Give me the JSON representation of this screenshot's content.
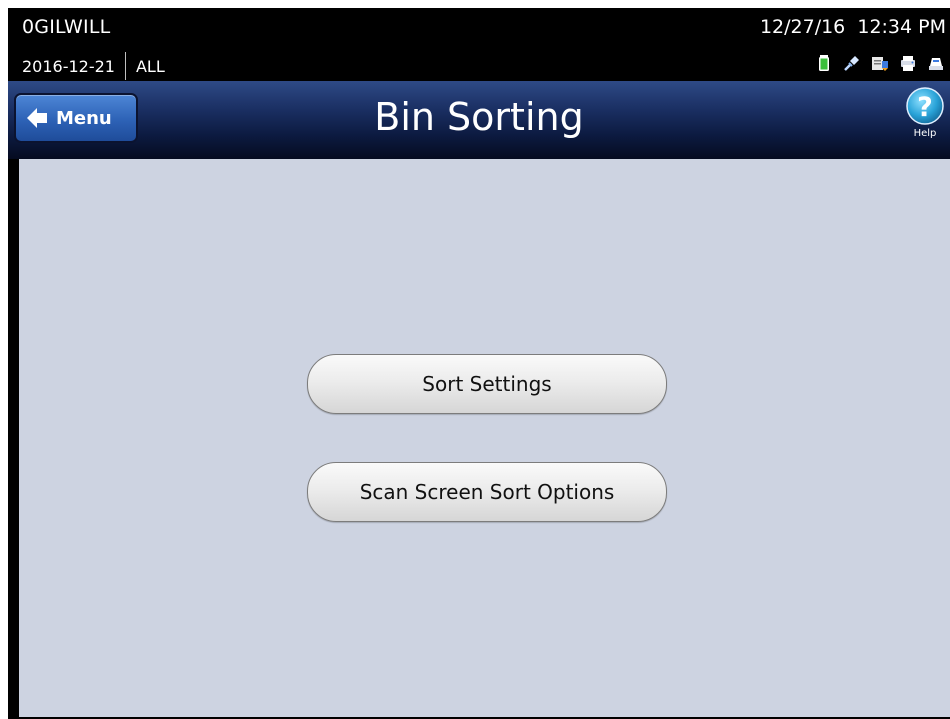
{
  "status_bar": {
    "user": "0GILWILL",
    "date": "2016-12-21",
    "filter": "ALL",
    "datetime": "12/27/16  12:34 PM",
    "icons": [
      "battery-icon",
      "connection-icon",
      "sync-icon",
      "printer-icon",
      "dock-icon"
    ]
  },
  "header": {
    "menu_label": "Menu",
    "title": "Bin Sorting",
    "help_label": "Help"
  },
  "main": {
    "buttons": [
      {
        "label": "Sort Settings"
      },
      {
        "label": "Scan Screen Sort Options"
      }
    ]
  },
  "colors": {
    "header_gradient_top": "#2e4a86",
    "header_gradient_bottom": "#050b20",
    "menu_button": "#2d62b6",
    "help_icon": "#29a3d8",
    "content_background": "#cdd3e1",
    "battery": "#3bbf3b"
  }
}
